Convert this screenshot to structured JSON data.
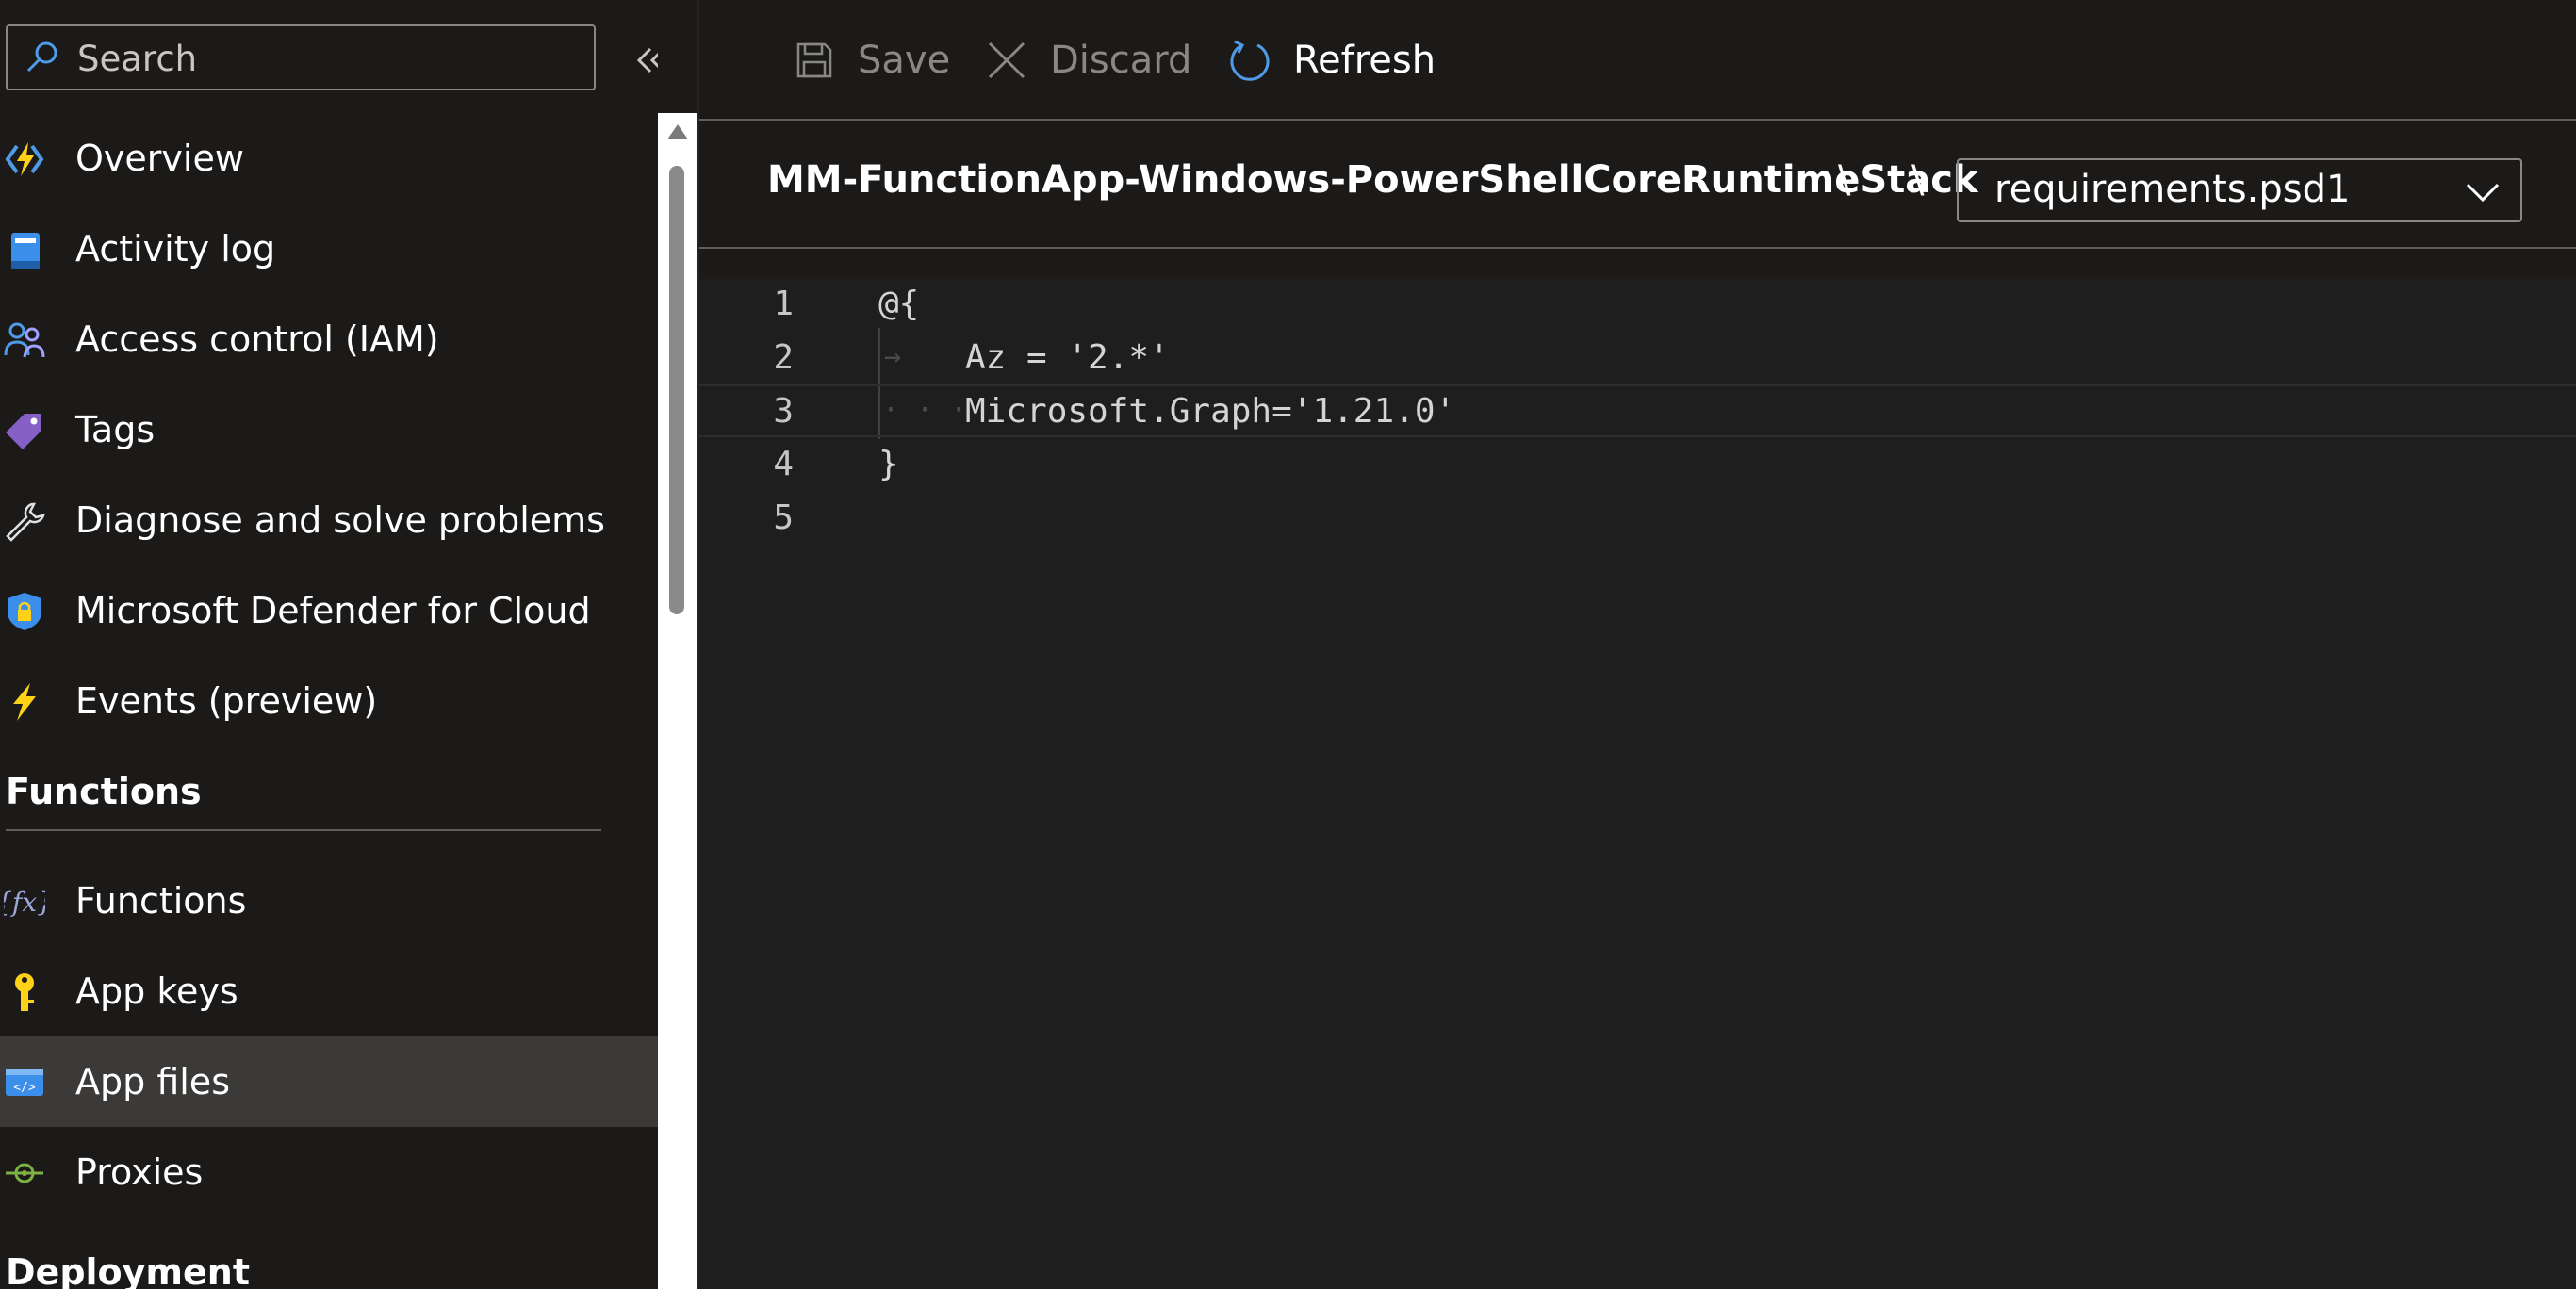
{
  "search": {
    "placeholder": "Search"
  },
  "nav": {
    "items": [
      {
        "label": "Overview",
        "icon": "function-app-icon"
      },
      {
        "label": "Activity log",
        "icon": "activity-log-icon"
      },
      {
        "label": "Access control (IAM)",
        "icon": "people-icon"
      },
      {
        "label": "Tags",
        "icon": "tag-icon"
      },
      {
        "label": "Diagnose and solve problems",
        "icon": "wrench-icon"
      },
      {
        "label": "Microsoft Defender for Cloud",
        "icon": "shield-lock-icon"
      },
      {
        "label": "Events (preview)",
        "icon": "lightning-icon"
      }
    ],
    "section_functions": "Functions",
    "function_items": [
      {
        "label": "Functions",
        "icon": "fx-icon"
      },
      {
        "label": "App keys",
        "icon": "key-icon"
      },
      {
        "label": "App files",
        "icon": "code-file-icon",
        "selected": true
      },
      {
        "label": "Proxies",
        "icon": "proxy-icon"
      }
    ],
    "section_deployment": "Deployment"
  },
  "toolbar": {
    "save_label": "Save",
    "discard_label": "Discard",
    "refresh_label": "Refresh"
  },
  "path": {
    "app_name": "MM-FunctionApp-Windows-PowerShellCoreRuntimeStack",
    "separator": "\\",
    "selected_file": "requirements.psd1"
  },
  "editor": {
    "lines": [
      {
        "number": "1",
        "text": "@{"
      },
      {
        "number": "2",
        "text": "Az = '2.*'"
      },
      {
        "number": "3",
        "text": "Microsoft.Graph='1.21.0'"
      },
      {
        "number": "4",
        "text": "}"
      },
      {
        "number": "5",
        "text": ""
      }
    ]
  },
  "colors": {
    "background": "#1b1a19",
    "selected_item": "#3b3a39",
    "accent_blue": "#4f9be8",
    "disabled_text": "#8a8886"
  }
}
